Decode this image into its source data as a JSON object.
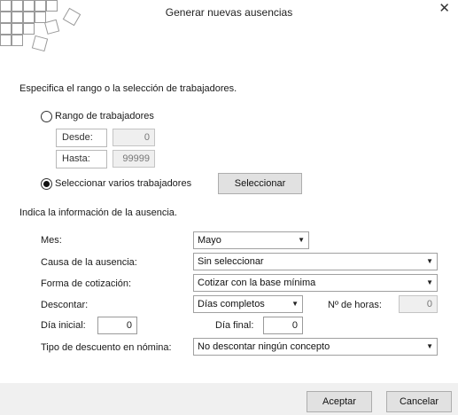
{
  "window": {
    "title": "Generar nuevas ausencias",
    "close_icon": "close-icon"
  },
  "range_section": {
    "heading": "Especifica el rango o la selección de trabajadores.",
    "option_range_label": "Rango de trabajadores",
    "option_range_selected": false,
    "desde_label": "Desde:",
    "desde_value": "0",
    "hasta_label": "Hasta:",
    "hasta_value": "99999",
    "option_select_label": "Seleccionar varios trabajadores",
    "option_select_selected": true,
    "select_button_label": "Seleccionar"
  },
  "absence_section": {
    "heading": "Indica la información de la ausencia.",
    "mes_label": "Mes:",
    "mes_value": "Mayo",
    "causa_label": "Causa de la ausencia:",
    "causa_value": "Sin seleccionar",
    "forma_label": "Forma de cotización:",
    "forma_value": "Cotizar con la base mínima",
    "descontar_label": "Descontar:",
    "descontar_value": "Días completos",
    "horas_label": "Nº de horas:",
    "horas_value": "0",
    "dia_inicial_label": "Día inicial:",
    "dia_inicial_value": "0",
    "dia_final_label": "Día final:",
    "dia_final_value": "0",
    "tipo_label": "Tipo de descuento en nómina:",
    "tipo_value": "No descontar ningún concepto"
  },
  "footer": {
    "accept_label": "Aceptar",
    "cancel_label": "Cancelar"
  }
}
